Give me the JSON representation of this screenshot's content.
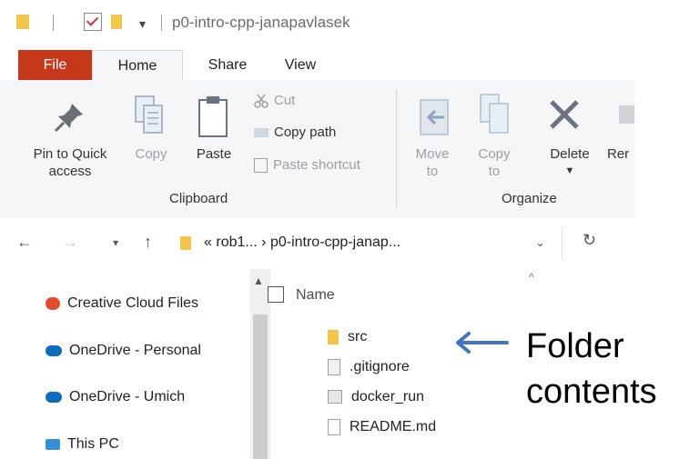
{
  "window": {
    "title": "p0-intro-cpp-janapavlasek"
  },
  "ribbon": {
    "tabs": {
      "file": "File",
      "home": "Home",
      "share": "Share",
      "view": "View"
    },
    "clipboard": {
      "pin_label_1": "Pin to Quick",
      "pin_label_2": "access",
      "copy_label": "Copy",
      "paste_label": "Paste",
      "cut_label": "Cut",
      "copy_path_label": "Copy path",
      "paste_shortcut_label": "Paste shortcut",
      "group_label": "Clipboard"
    },
    "organize": {
      "move_label_1": "Move",
      "move_label_2": "to",
      "copy_to_label_1": "Copy",
      "copy_to_label_2": "to",
      "delete_label": "Delete",
      "rename_label": "Rer",
      "group_label": "Organize"
    }
  },
  "address": {
    "prefix": "«",
    "path": "rob1... › p0-intro-cpp-janap..."
  },
  "nav_pane": {
    "items": [
      {
        "label": "Creative Cloud Files",
        "icon": "creative-cloud-icon"
      },
      {
        "label": "OneDrive - Personal",
        "icon": "onedrive-icon"
      },
      {
        "label": "OneDrive - Umich",
        "icon": "onedrive-icon"
      },
      {
        "label": "This PC",
        "icon": "this-pc-icon"
      }
    ]
  },
  "file_list": {
    "column_header": "Name",
    "files": [
      {
        "name": "src",
        "icon": "folder-icon"
      },
      {
        "name": ".gitignore",
        "icon": "text-file-icon"
      },
      {
        "name": "docker_run",
        "icon": "script-file-icon"
      },
      {
        "name": "README.md",
        "icon": "file-icon"
      }
    ]
  },
  "annotation": {
    "line1": "Folder",
    "line2": "contents",
    "color": "#4472c4"
  }
}
